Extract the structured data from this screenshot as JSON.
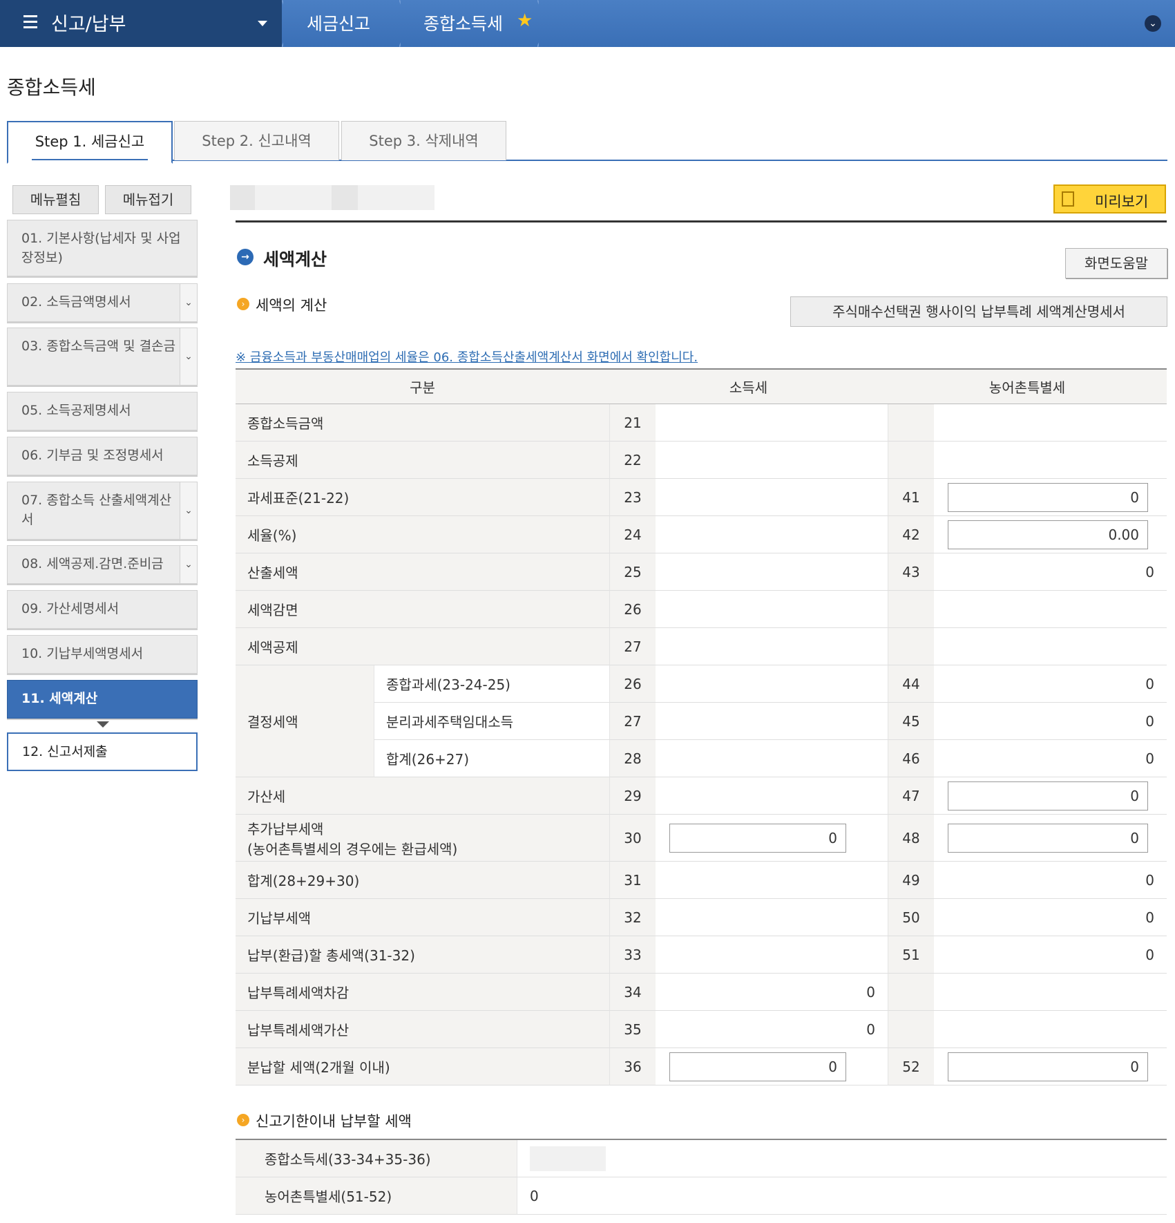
{
  "topbar": {
    "menu_title": "신고/납부",
    "crumb1": "세금신고",
    "crumb2": "종합소득세",
    "colors": {
      "menu_bg": "#1f4577",
      "bar_bg": "#3a6fb6",
      "star": "#ffc81e"
    },
    "icons": [
      "hamburger-icon",
      "caret-down-icon",
      "star-icon",
      "chevron-down-circle-icon"
    ]
  },
  "page_title": "종합소득세",
  "tabs": [
    {
      "label": "Step 1. 세금신고",
      "active": true
    },
    {
      "label": "Step 2. 신고내역"
    },
    {
      "label": "Step 3. 삭제내역"
    }
  ],
  "side": {
    "expand": "메뉴펼침",
    "collapse": "메뉴접기",
    "items": [
      {
        "label": "01. 기본사항(납세자 및 사업장정보)"
      },
      {
        "label": "02. 소득금액명세서"
      },
      {
        "label": "03. 종합소득금액 및 결손금"
      },
      {
        "label": "05. 소득공제명세서"
      },
      {
        "label": "06. 기부금 및 조정명세서"
      },
      {
        "label": "07. 종합소득 산출세액계산서"
      },
      {
        "label": "08. 세액공제.감면.준비금"
      },
      {
        "label": "09. 가산세명세서"
      },
      {
        "label": "10. 기납부세액명세서"
      },
      {
        "label": "11. 세액계산"
      },
      {
        "label": "12. 신고서제출"
      }
    ]
  },
  "preview": "미리보기",
  "section_title": "세액계산",
  "help": "화면도움말",
  "calc_title": "세액의 계산",
  "stock_button": "주식매수선택권 행사이익 납부특례 세액계산명세서",
  "notice": "※ 금융소득과 부동산매매업의 세율은 06. 종합소득산출세액계산서 화면에서 확인합니다.",
  "table": {
    "headers": [
      "구분",
      "소득세",
      "농어촌특별세"
    ],
    "rows": [
      {
        "label": "종합소득금액",
        "n1": "21",
        "v1": "",
        "n2": "",
        "v2": ""
      },
      {
        "label": "소득공제",
        "n1": "22",
        "v1": "",
        "n2": "",
        "v2": ""
      },
      {
        "label": "과세표준(21-22)",
        "n1": "23",
        "v1": "",
        "n2": "41",
        "v2": "0"
      },
      {
        "label": "세율(%)",
        "n1": "24",
        "v1": "",
        "n2": "42",
        "v2": "0.00"
      },
      {
        "label": "산출세액",
        "n1": "25",
        "v1": "",
        "n2": "43",
        "v2": "0"
      },
      {
        "label": "세액감면",
        "n1": "26",
        "v1": "",
        "n2": "",
        "v2": ""
      },
      {
        "label": "세액공제",
        "n1": "27",
        "v1": "",
        "n2": "",
        "v2": ""
      },
      {
        "group": "결정세액",
        "label": "종합과세(23-24-25)",
        "n1": "26",
        "v1": "",
        "n2": "44",
        "v2": "0"
      },
      {
        "group": "결정세액",
        "label": "분리과세주택임대소득",
        "n1": "27",
        "v1": "",
        "n2": "45",
        "v2": "0"
      },
      {
        "group": "결정세액",
        "label": "합계(26+27)",
        "n1": "28",
        "v1": "",
        "n2": "46",
        "v2": "0"
      },
      {
        "label": "가산세",
        "n1": "29",
        "v1": "",
        "n2": "47",
        "v2": "0"
      },
      {
        "label": "추가납부세액",
        "label2": "(농어촌특별세의 경우에는 환급세액)",
        "n1": "30",
        "v1": "0",
        "n2": "48",
        "v2": "0"
      },
      {
        "label": "합계(28+29+30)",
        "n1": "31",
        "v1": "",
        "n2": "49",
        "v2": "0"
      },
      {
        "label": "기납부세액",
        "n1": "32",
        "v1": "",
        "n2": "50",
        "v2": "0"
      },
      {
        "label": "납부(환급)할 총세액(31-32)",
        "n1": "33",
        "v1": "",
        "n2": "51",
        "v2": "0"
      },
      {
        "label": "납부특례세액차감",
        "n1": "34",
        "v1": "0",
        "n2": "",
        "v2": ""
      },
      {
        "label": "납부특례세액가산",
        "n1": "35",
        "v1": "0",
        "n2": "",
        "v2": ""
      },
      {
        "label": "분납할 세액(2개월 이내)",
        "n1": "36",
        "v1": "0",
        "n2": "52",
        "v2": "0"
      }
    ]
  },
  "due_title": "신고기한이내 납부할 세액",
  "due": [
    {
      "label": "종합소득세(33-34+35-36)",
      "value": ""
    },
    {
      "label": "농어촌특별세(51-52)",
      "value": "0"
    }
  ]
}
